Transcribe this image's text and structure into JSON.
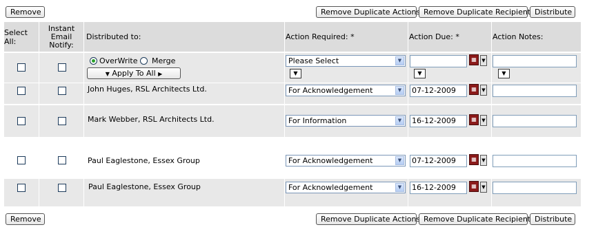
{
  "toolbar": {
    "remove": "Remove",
    "remove_dup_actions": "Remove Duplicate Actions",
    "remove_dup_recipients": "Remove Duplicate Recipients",
    "distribute": "Distribute"
  },
  "headers": {
    "select_all": "Select All:",
    "instant_email_line1": "Instant",
    "instant_email_line2": "Email",
    "instant_email_line3": "Notify:",
    "distributed_to": "Distributed to:",
    "action_required": "Action Required: *",
    "action_due": "Action Due: *",
    "action_notes": "Action Notes:"
  },
  "apply_row": {
    "overwrite_label": "OverWrite",
    "merge_label": "Merge",
    "overwrite_selected": true,
    "apply_button": "Apply To All",
    "action_select": "Please Select",
    "due_value": "",
    "notes_value": ""
  },
  "rows": [
    {
      "name": "John Huges, RSL Architects Ltd.",
      "action": "For Acknowledgement",
      "due": "07-12-2009",
      "notes": ""
    },
    {
      "name": "Mark Webber, RSL Architects Ltd.",
      "action": "For Information",
      "due": "16-12-2009",
      "notes": ""
    },
    {
      "name": "Paul Eaglestone, Essex Group",
      "action": "For Acknowledgement",
      "due": "07-12-2009",
      "notes": ""
    },
    {
      "name": "Paul Eaglestone, Essex Group",
      "action": "For Acknowledgement",
      "due": "16-12-2009",
      "notes": ""
    }
  ],
  "colors": {
    "header_bg": "#dcdcdc",
    "row_bg": "#e8e8e8",
    "calendar_icon": "#8b1a1a"
  },
  "icons": {
    "dropdown": "chevron-down-icon",
    "calendar": "calendar-icon",
    "apply_arrow_left": "triangle-down-icon",
    "apply_arrow_right": "triangle-right-icon"
  }
}
